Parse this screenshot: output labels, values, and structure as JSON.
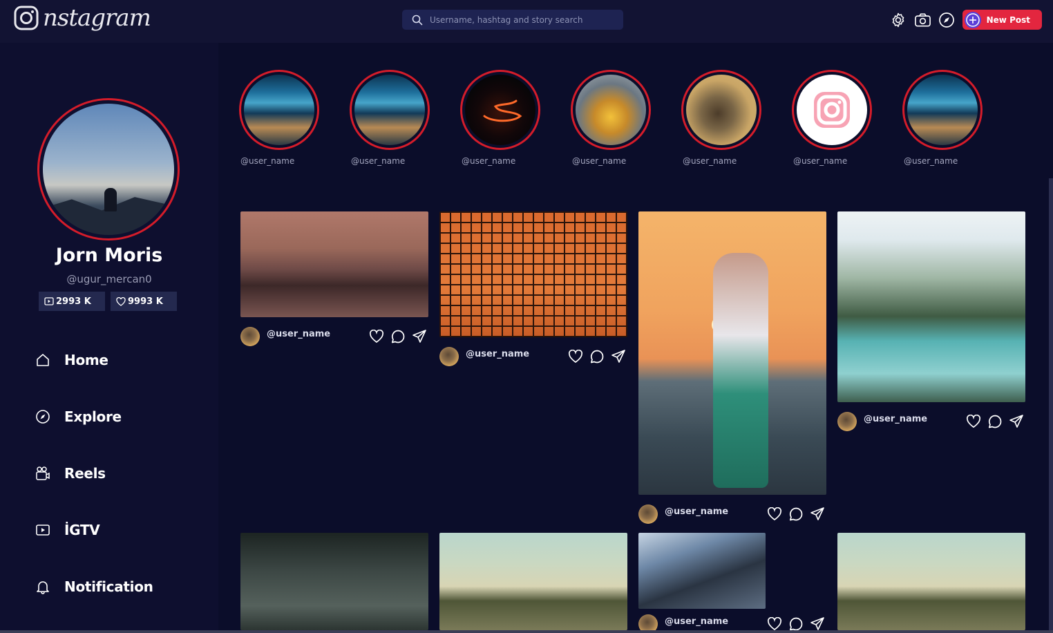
{
  "app": {
    "logo_text": "nstagram",
    "search_placeholder": "Username, hashtag and story search",
    "new_post_label": "New Post"
  },
  "profile": {
    "name": "Jorn Moris",
    "handle": "@ugur_mercan0",
    "stats": [
      {
        "icon": "play-icon",
        "value": "2993 K"
      },
      {
        "icon": "heart-icon",
        "value": "9993 K"
      }
    ]
  },
  "nav": [
    {
      "icon": "home-icon",
      "label": "Home"
    },
    {
      "icon": "compass-icon",
      "label": "Explore"
    },
    {
      "icon": "reels-icon",
      "label": "Reels"
    },
    {
      "icon": "igtv-icon",
      "label": "İGTV"
    },
    {
      "icon": "bell-icon",
      "label": "Notification"
    }
  ],
  "stories": [
    {
      "user": "@user_name",
      "image": "city"
    },
    {
      "user": "@user_name",
      "image": "city"
    },
    {
      "user": "@user_name",
      "image": "worm"
    },
    {
      "user": "@user_name",
      "image": "cake"
    },
    {
      "user": "@user_name",
      "image": "rhino"
    },
    {
      "user": "@user_name",
      "image": "instagram-logo"
    },
    {
      "user": "@user_name",
      "image": "city"
    }
  ],
  "posts": [
    {
      "user": "@user_name",
      "image": "anime-hand"
    },
    {
      "user": "@user_name",
      "image": "tennis-net"
    },
    {
      "user": "@user_name",
      "image": "sunset-beach"
    },
    {
      "user": "@user_name",
      "image": "mountain-lake"
    },
    {
      "user": "",
      "image": "cloudy-sky"
    },
    {
      "user": "",
      "image": "green-hills"
    },
    {
      "user": "@user_name",
      "image": "skyscrapers"
    },
    {
      "user": "",
      "image": "green-hills"
    }
  ],
  "colors": {
    "background": "#0b0d2a",
    "sidebar": "#0e0f2f",
    "accent_red": "#d41c2a",
    "new_post": "#e3263f"
  }
}
